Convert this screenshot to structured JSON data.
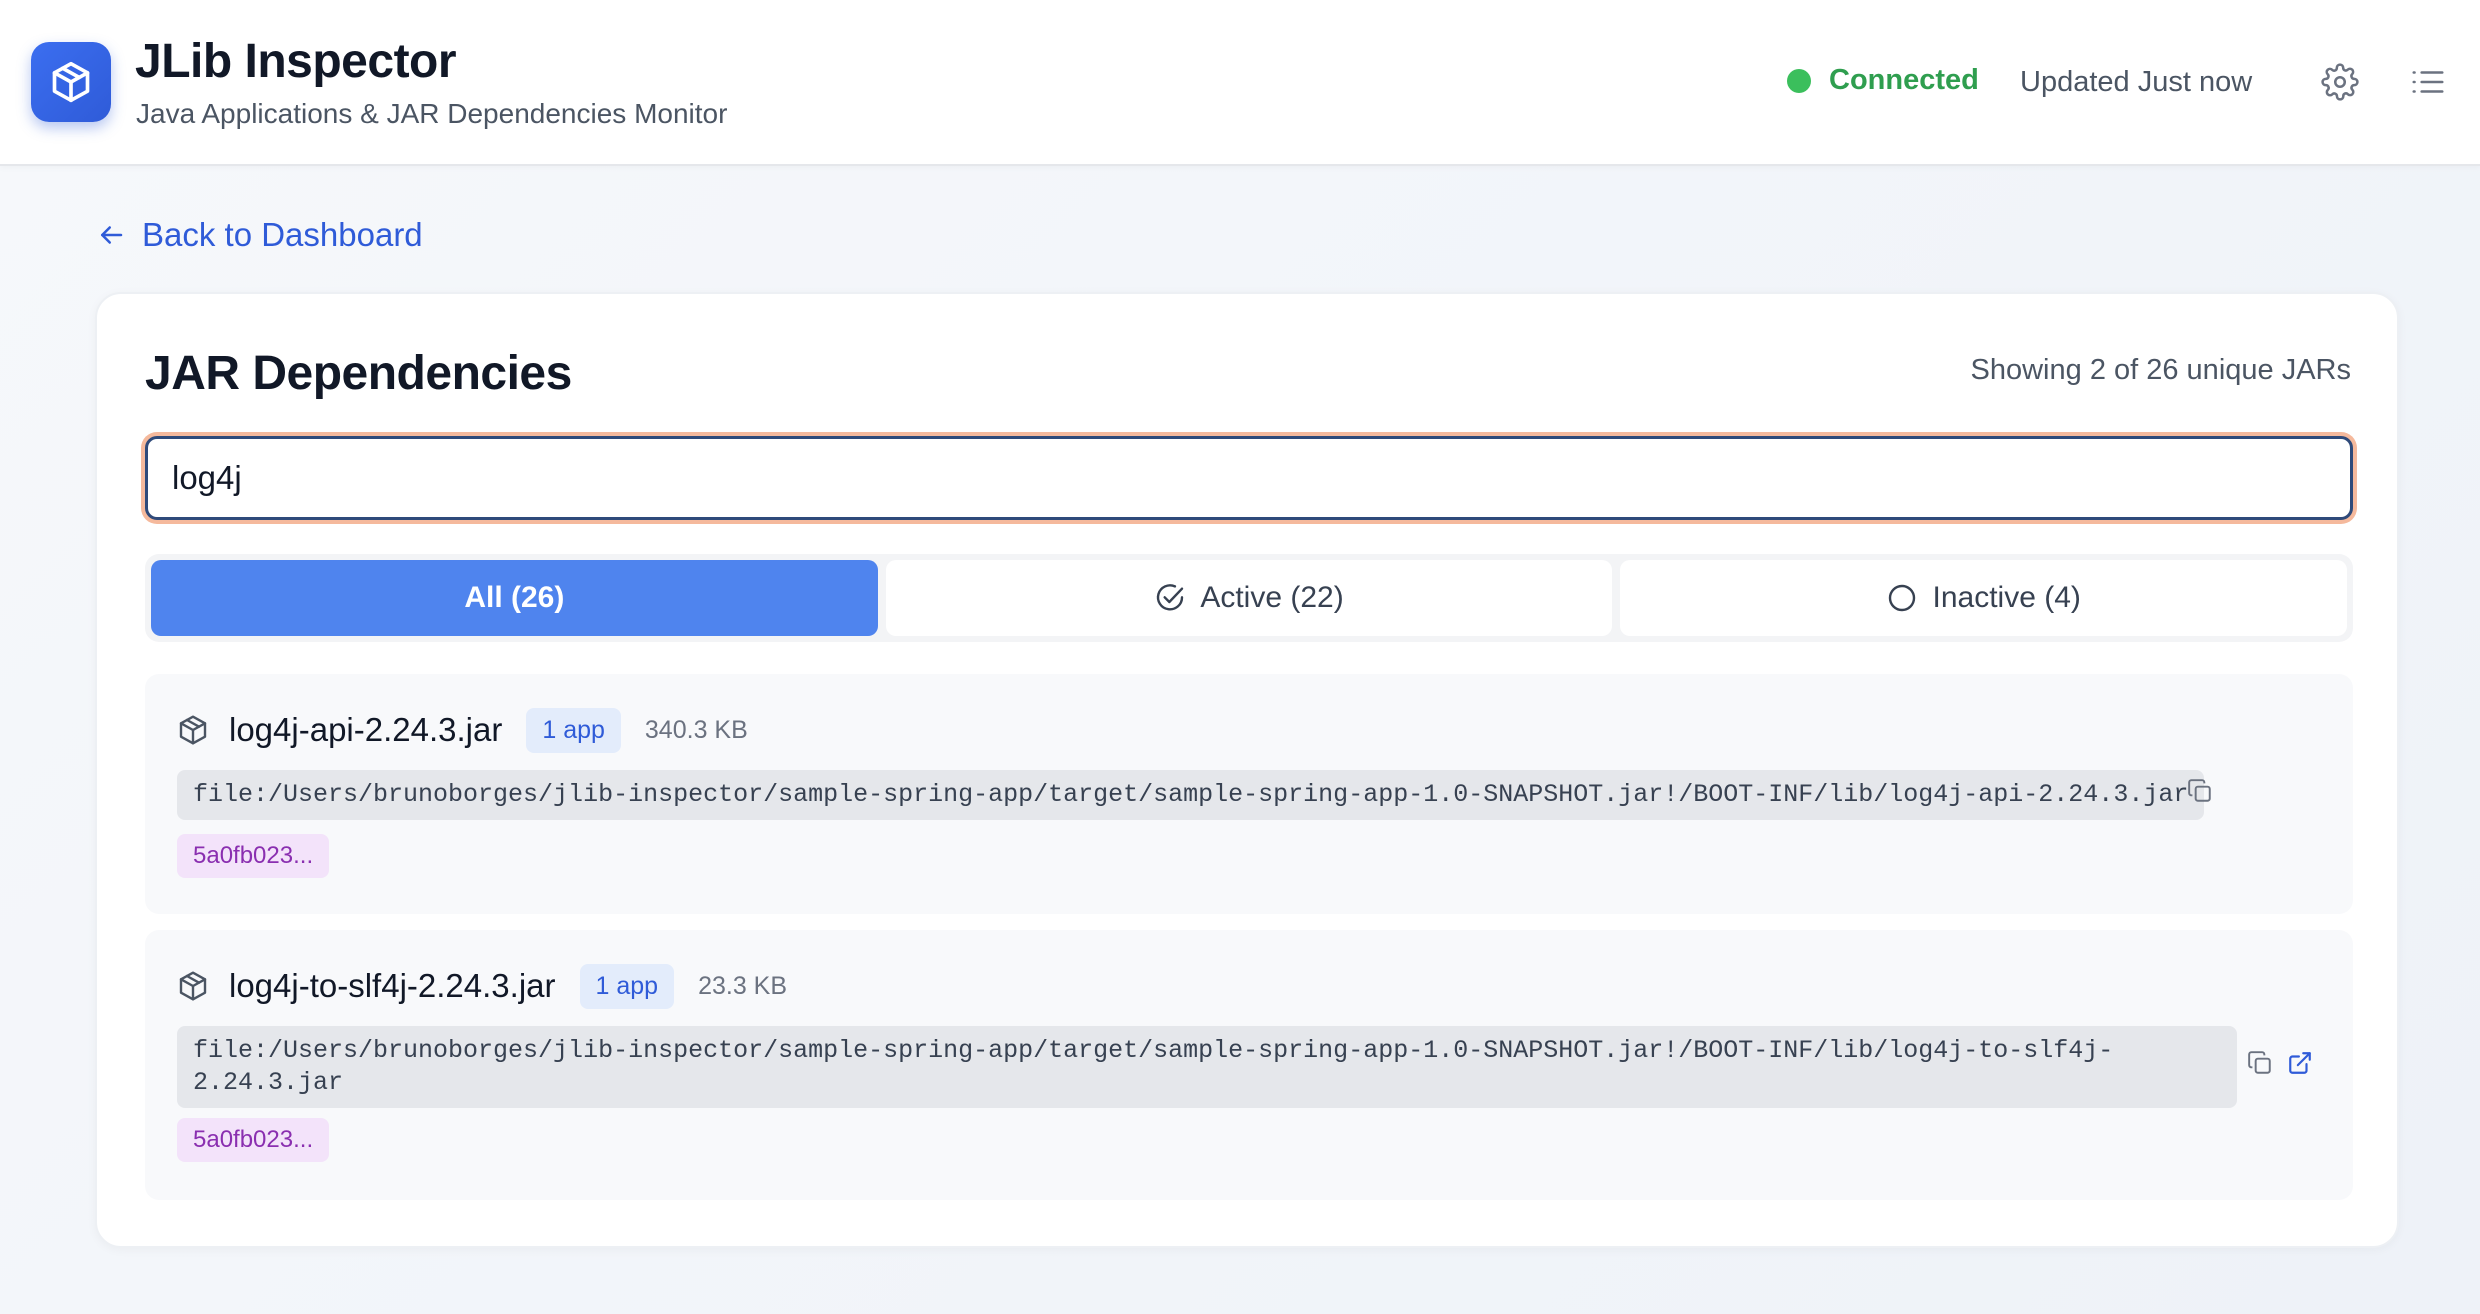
{
  "header": {
    "title": "JLib Inspector",
    "subtitle": "Java Applications & JAR Dependencies Monitor",
    "status": "Connected",
    "status_color": "#3bbf5c",
    "updated": "Updated Just now",
    "icons": [
      "package-icon",
      "gear-icon",
      "list-icon"
    ]
  },
  "nav": {
    "back_label": "Back to Dashboard"
  },
  "main": {
    "title": "JAR Dependencies",
    "showing": "Showing 2 of 26 unique JARs",
    "search": {
      "value": "log4j",
      "placeholder": ""
    },
    "tabs": [
      {
        "label": "All (26)",
        "active": true
      },
      {
        "label": "Active (22)",
        "active": false,
        "icon": "check-circle-icon"
      },
      {
        "label": "Inactive (4)",
        "active": false,
        "icon": "circle-icon"
      }
    ],
    "jars": [
      {
        "name": "log4j-api-2.24.3.jar",
        "apps": "1 app",
        "size": "340.3 KB",
        "path": "file:/Users/brunoborges/jlib-inspector/sample-spring-app/target/sample-spring-app-1.0-SNAPSHOT.jar!/BOOT-INF/lib/log4j-api-2.24.3.jar",
        "hash": "5a0fb023..."
      },
      {
        "name": "log4j-to-slf4j-2.24.3.jar",
        "apps": "1 app",
        "size": "23.3 KB",
        "path_line1": "file:/Users/brunoborges/jlib-inspector/sample-spring-app/target/sample-spring-app-1.0-SNAPSHOT.jar!/BOOT-INF/lib/log4j-to-slf4j-",
        "path_line2": "2.24.3.jar",
        "hash": "5a0fb023..."
      }
    ]
  }
}
